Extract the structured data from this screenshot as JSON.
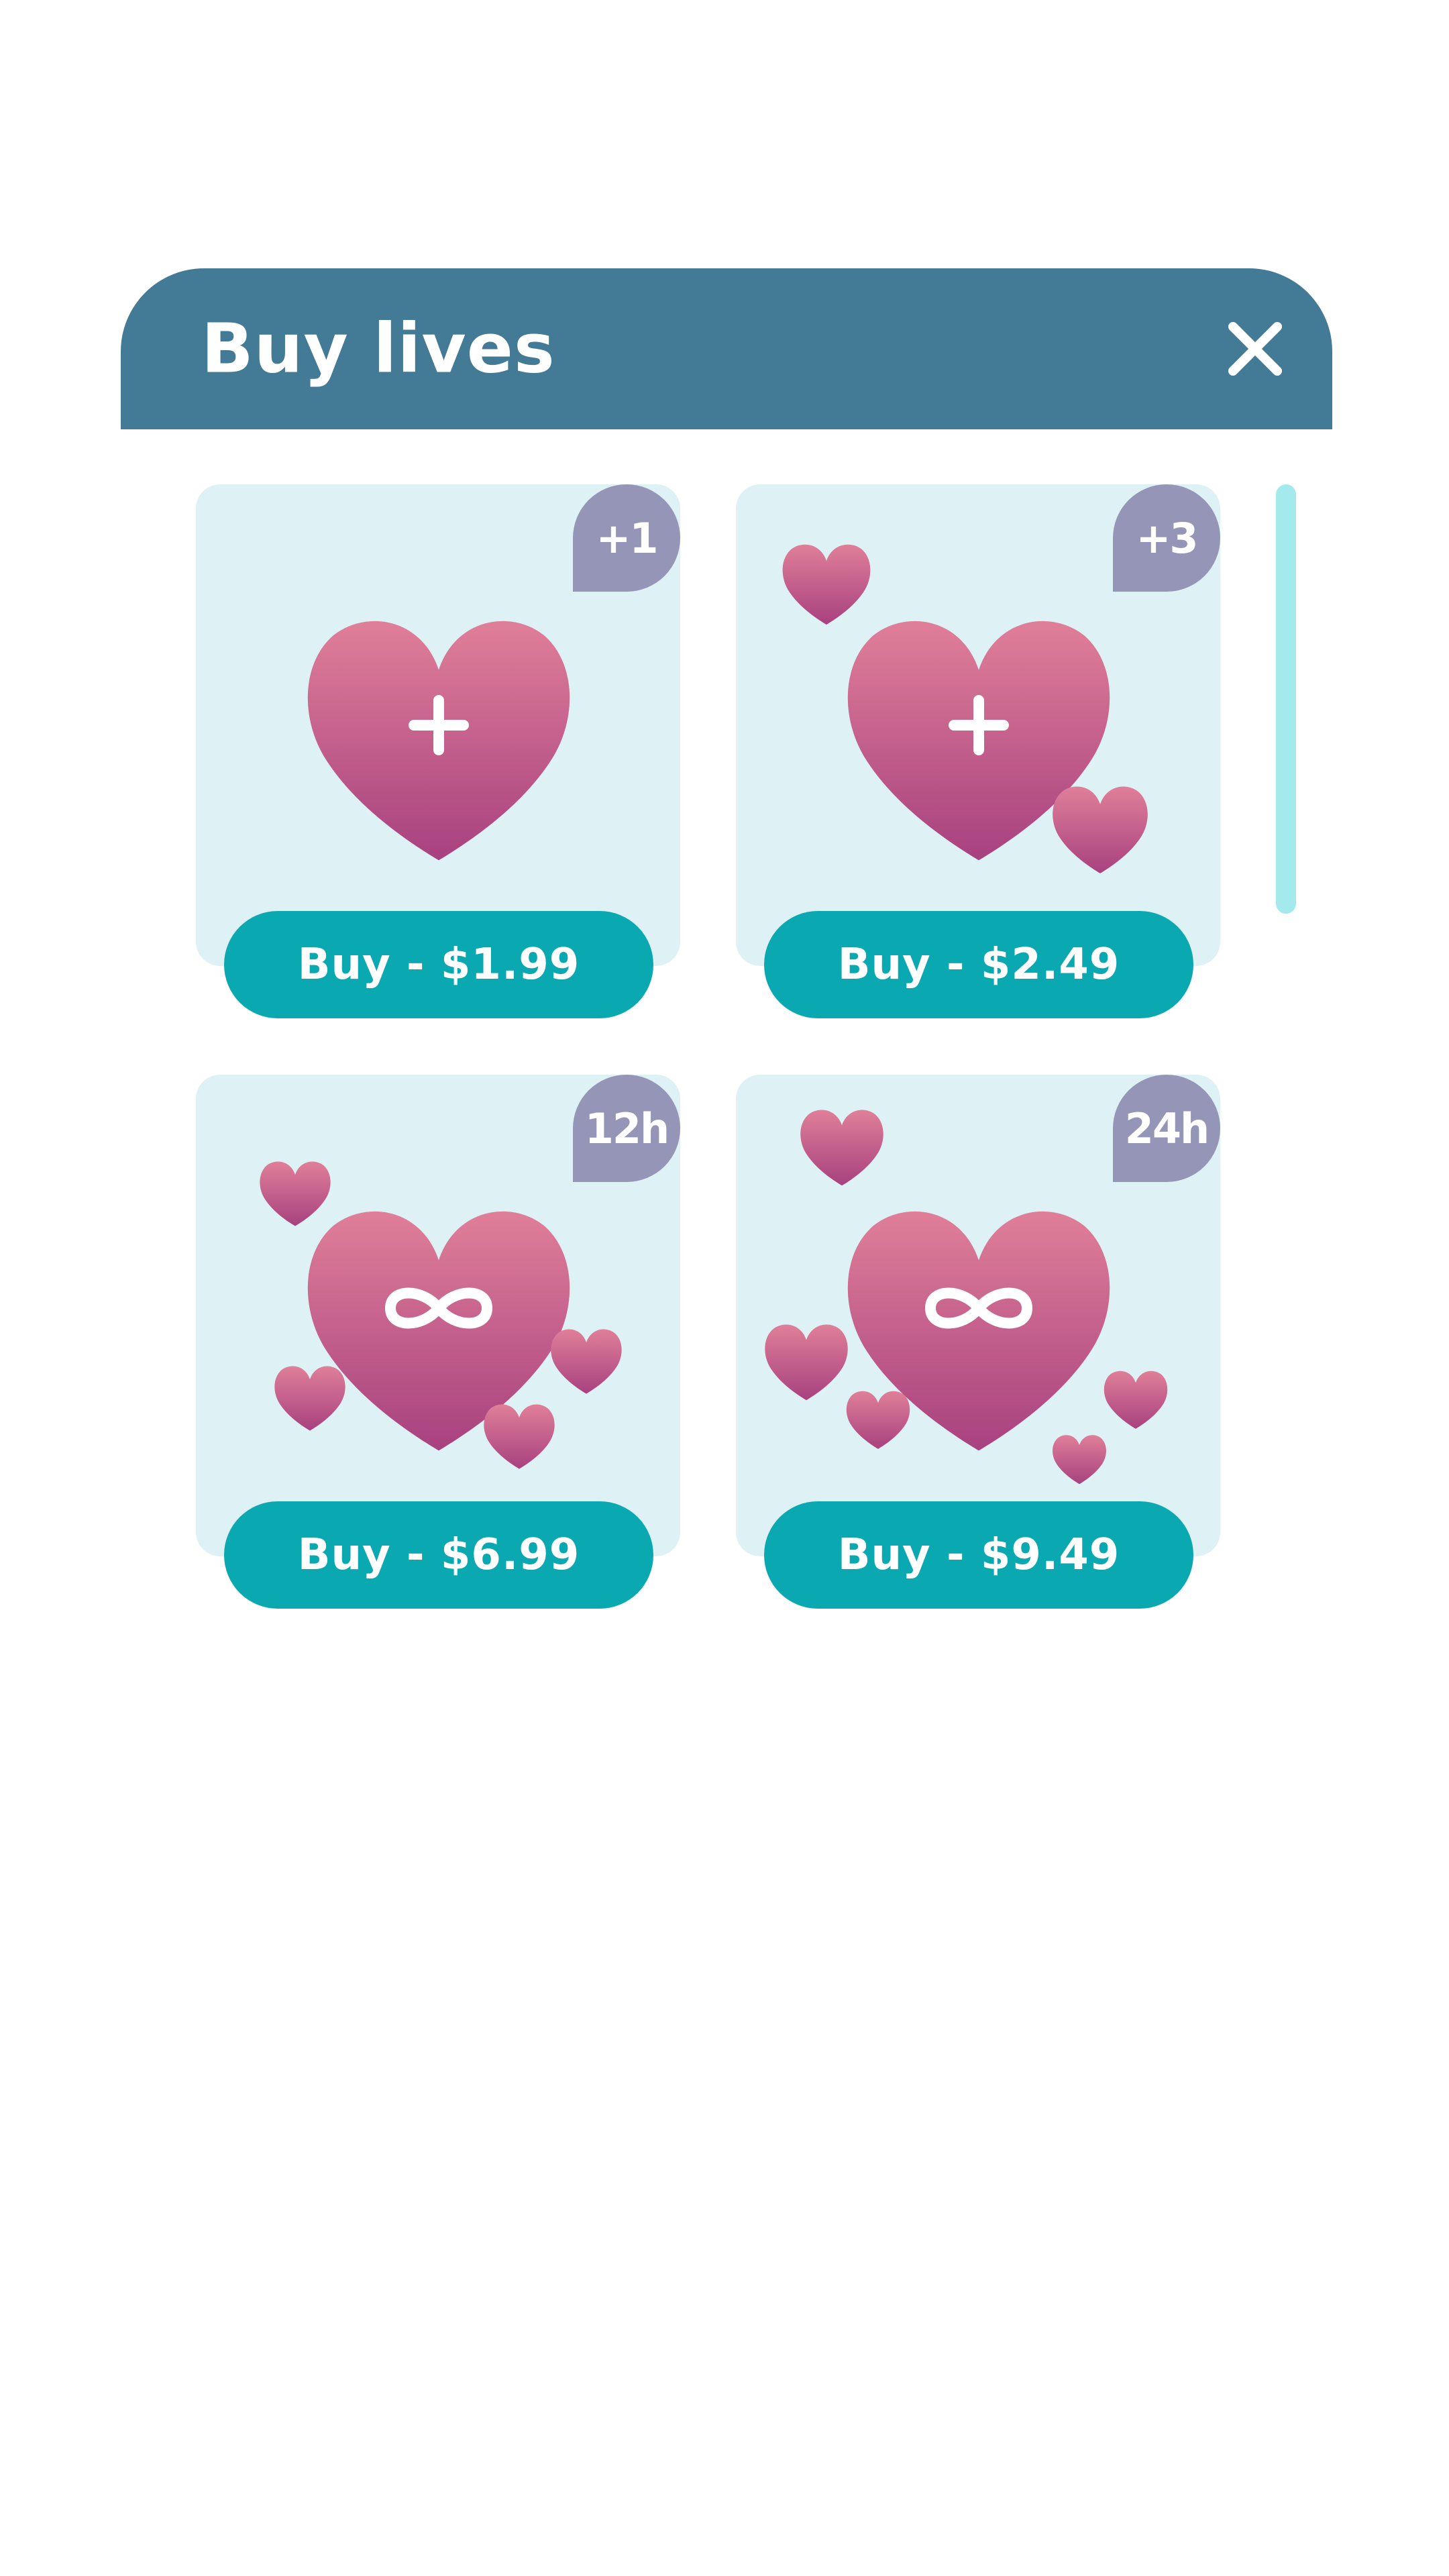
{
  "dialog": {
    "title": "Buy lives",
    "close_icon": "close-icon"
  },
  "colors": {
    "header": "#437a96",
    "card": "#def1f4",
    "badge": "#9595b8",
    "button": "#0aa9b2",
    "scrollbar": "#a4e9ec",
    "heart_top": "#e07f99",
    "heart_bottom": "#a8417f"
  },
  "offers": [
    {
      "badge": "+1",
      "button_label": "Buy - $1.99",
      "icon": "heart-plus-icon"
    },
    {
      "badge": "+3",
      "button_label": "Buy - $2.49",
      "icon": "heart-plus-icon"
    },
    {
      "badge": "12h",
      "button_label": "Buy - $6.99",
      "icon": "heart-infinity-icon"
    },
    {
      "badge": "24h",
      "button_label": "Buy - $9.49",
      "icon": "heart-infinity-icon"
    }
  ]
}
